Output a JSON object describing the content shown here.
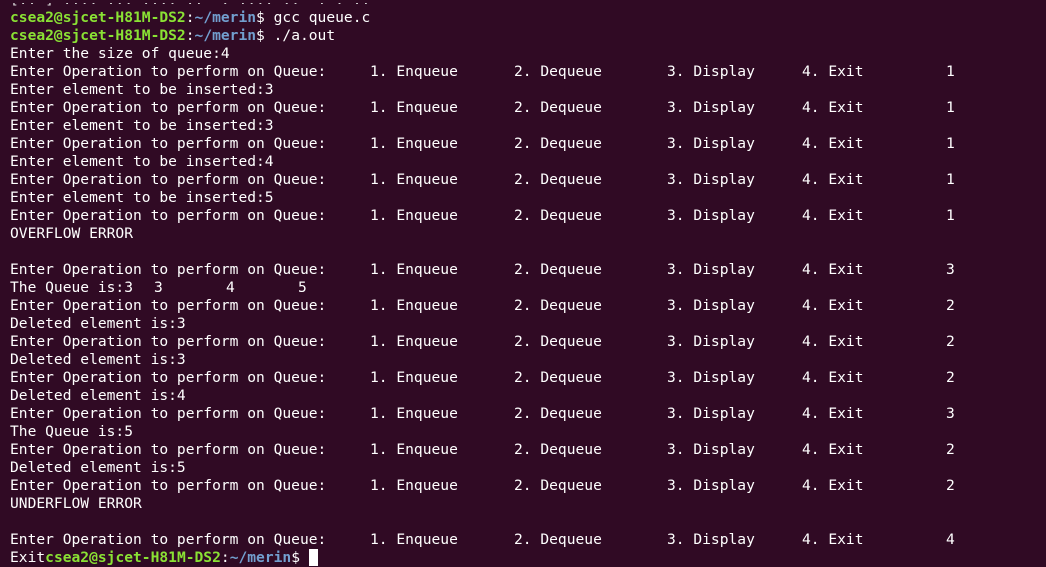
{
  "partial_top": "[.. ] .... ... .... ..  . .... ..  . . ..",
  "prompt": {
    "user": "csea2@sjcet-H81M-DS2",
    "sep": ":",
    "path": "~/merin",
    "symbol": "$ "
  },
  "cmd1": "gcc queue.c",
  "cmd2": "./a.out",
  "size_prompt": "Enter the size of queue:4",
  "menu": {
    "prompt": "Enter Operation to perform on Queue:",
    "opt1": "1. Enqueue",
    "opt2": "2. Dequeue",
    "opt3": "3. Display",
    "opt4": "4. Exit"
  },
  "choices": [
    "1",
    "1",
    "1",
    "1",
    "1",
    "3",
    "2",
    "2",
    "2",
    "3",
    "2",
    "2",
    "4"
  ],
  "insert_lines": [
    "Enter element to be inserted:3",
    "Enter element to be inserted:3",
    "Enter element to be inserted:4",
    "Enter element to be inserted:5"
  ],
  "overflow": "OVERFLOW ERROR",
  "queue_prefix": "The Queue is:3",
  "queue_vals": [
    "3",
    "4",
    "5"
  ],
  "deleted": [
    "Deleted element is:3",
    "Deleted element is:3",
    "Deleted element is:4",
    "Deleted element is:5"
  ],
  "queue_single": "The Queue is:5",
  "underflow": "UNDERFLOW ERROR",
  "exit_text": "Exit"
}
